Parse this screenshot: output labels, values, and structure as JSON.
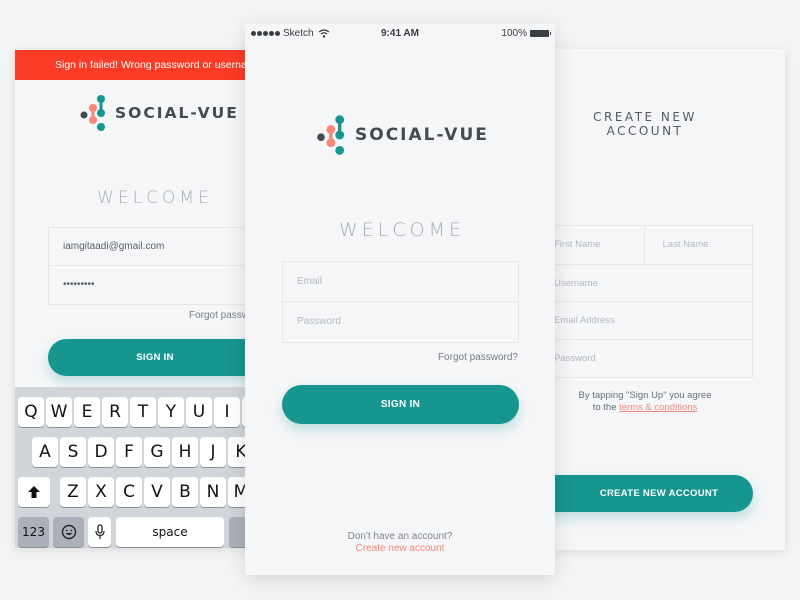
{
  "brand": {
    "name": "SOCIAL-VUE",
    "colors": {
      "teal": "#16968e",
      "coral": "#f6877a",
      "dark": "#454a4f",
      "error": "#fb3b26"
    }
  },
  "left_screen": {
    "error_banner": "Sign in failed! Wrong password or usernam",
    "welcome": "WELCOME",
    "email_value": "iamgitaadi@gmail.com",
    "password_value": "•••••••••",
    "forgot_password": "Forgot passw",
    "sign_in_button": "SIGN IN",
    "keyboard": {
      "row1": [
        "Q",
        "W",
        "E",
        "R",
        "T",
        "Y",
        "U",
        "I"
      ],
      "row2": [
        "A",
        "S",
        "D",
        "F",
        "G",
        "H",
        "J",
        "K"
      ],
      "row3": [
        "Z",
        "X",
        "C",
        "V",
        "B",
        "N",
        "M"
      ],
      "numbers_key": "123",
      "space_key": "space"
    }
  },
  "center_screen": {
    "status_bar": {
      "carrier": "Sketch",
      "time": "9:41 AM",
      "battery": "100%"
    },
    "welcome": "WELCOME",
    "email_placeholder": "Email",
    "password_placeholder": "Password",
    "forgot_password": "Forgot password?",
    "sign_in_button": "SIGN IN",
    "no_account_text": "Don't have an account?",
    "create_account_link": "Create new account"
  },
  "right_screen": {
    "title_line1": "CREATE NEW",
    "title_line2": "ACCOUNT",
    "first_name_placeholder": "First Name",
    "last_name_placeholder": "Last Name",
    "username_placeholder": "Username",
    "email_placeholder": "Email Address",
    "password_placeholder": "Password",
    "terms_text_1": "By tapping \"Sign Up\" you agree",
    "terms_text_2": "to the",
    "terms_link": "terms & conditions",
    "create_button": "CREATE NEW ACCOUNT"
  }
}
